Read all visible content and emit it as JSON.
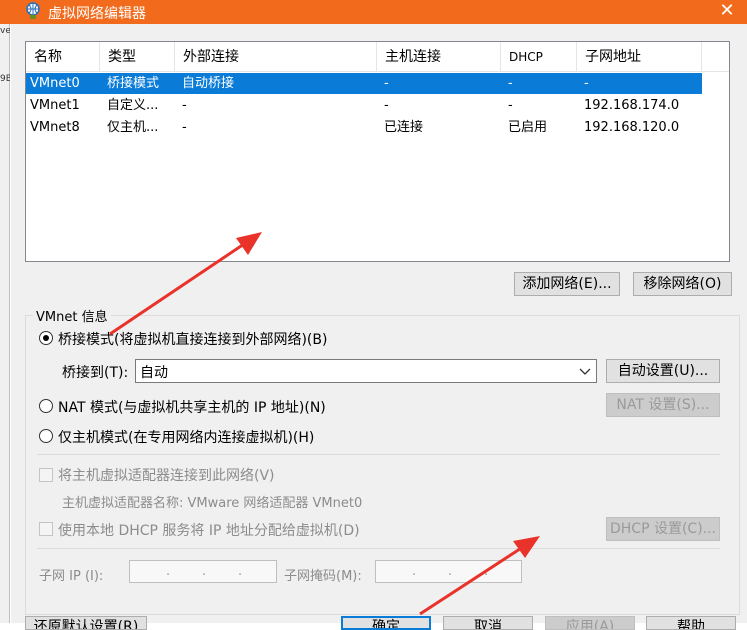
{
  "window": {
    "title": "虚拟网络编辑器",
    "close_glyph": "✕"
  },
  "left_strip": {
    "fragments": [
      "ve",
      "9B"
    ]
  },
  "table": {
    "columns": [
      "名称",
      "类型",
      "外部连接",
      "主机连接",
      "DHCP",
      "子网地址"
    ],
    "rows": [
      {
        "name": "VMnet0",
        "type": "桥接模式",
        "external": "自动桥接",
        "host": "-",
        "dhcp": "-",
        "subnet": "-",
        "selected": true
      },
      {
        "name": "VMnet1",
        "type": "自定义...",
        "external": "-",
        "host": "-",
        "dhcp": "-",
        "subnet": "192.168.174.0",
        "selected": false
      },
      {
        "name": "VMnet8",
        "type": "仅主机...",
        "external": "-",
        "host": "已连接",
        "dhcp": "已启用",
        "subnet": "192.168.120.0",
        "selected": false
      }
    ]
  },
  "buttons": {
    "add_network": "添加网络(E)...",
    "remove_network": "移除网络(O)",
    "auto_settings": "自动设置(U)...",
    "nat_settings": "NAT 设置(S)...",
    "dhcp_settings": "DHCP 设置(C)...",
    "restore_defaults": "还原默认设置(R)",
    "ok": "确定",
    "cancel": "取消",
    "apply": "应用(A)",
    "help": "帮助"
  },
  "vmnet_info": {
    "group_label": "VMnet 信息",
    "bridged_label": "桥接模式(将虚拟机直接连接到外部网络)(B)",
    "bridge_to_label": "桥接到(T):",
    "bridge_to_value": "自动",
    "nat_label": "NAT 模式(与虚拟机共享主机的 IP 地址)(N)",
    "host_only_label": "仅主机模式(在专用网络内连接虚拟机)(H)",
    "connect_adapter_label": "将主机虚拟适配器连接到此网络(V)",
    "adapter_name_label": "主机虚拟适配器名称: VMware 网络适配器 VMnet0",
    "use_dhcp_label": "使用本地 DHCP 服务将 IP 地址分配给虚拟机(D)",
    "subnet_ip_label": "子网 IP (I):",
    "subnet_mask_label": "子网掩码(M):",
    "ip_dot": "."
  },
  "colors": {
    "titlebar": "#f26b1d",
    "selection": "#0a7bd7",
    "annotation_arrow": "#e8322a"
  }
}
